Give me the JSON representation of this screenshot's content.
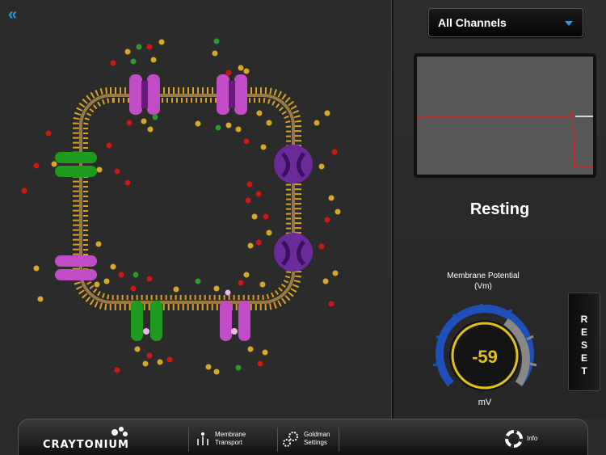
{
  "nav": {
    "back_icon": "double-chevron-left-icon",
    "back_glyph": "«"
  },
  "channel_select": {
    "selected": "All Channels"
  },
  "status": {
    "state": "Resting"
  },
  "membrane": {
    "label": "Membrane Potential (Vm)",
    "value": "-59",
    "unit": "mV"
  },
  "reset": {
    "label": "RESET"
  },
  "toolbar": {
    "brand": "CRAYTONIUM",
    "membrane_transport": "Membrane Transport",
    "goldman_settings": "Goldman Settings",
    "info": "Info"
  },
  "colors": {
    "accent": "#2a9bd8",
    "gauge_ring": "#e0c21b",
    "trace": "#d42020",
    "sodium": "#d01616",
    "potassium": "#d8a824",
    "chloride": "#2a9a2a"
  }
}
